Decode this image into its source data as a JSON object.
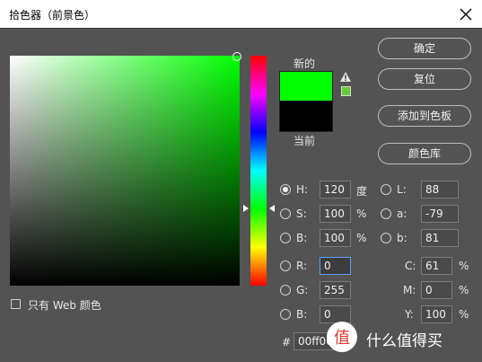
{
  "window": {
    "title": "拾色器（前景色）"
  },
  "swatches": {
    "new_label": "新的",
    "current_label": "当前",
    "new_color": "#00ff00",
    "current_color": "#000000",
    "websafe_color": "#66cc33"
  },
  "buttons": {
    "ok": "确定",
    "reset": "复位",
    "add_to_swatches": "添加到色板",
    "color_libraries": "颜色库"
  },
  "hsb": {
    "h": {
      "label": "H:",
      "value": "120",
      "unit": "度"
    },
    "s": {
      "label": "S:",
      "value": "100",
      "unit": "%"
    },
    "b": {
      "label": "B:",
      "value": "100",
      "unit": "%"
    }
  },
  "lab": {
    "l": {
      "label": "L:",
      "value": "88"
    },
    "a": {
      "label": "a:",
      "value": "-79"
    },
    "b": {
      "label": "b:",
      "value": "81"
    }
  },
  "rgb": {
    "r": {
      "label": "R:",
      "value": "0"
    },
    "g": {
      "label": "G:",
      "value": "255"
    },
    "b": {
      "label": "B:",
      "value": "0"
    }
  },
  "cmyk": {
    "c": {
      "label": "C:",
      "value": "61",
      "unit": "%"
    },
    "m": {
      "label": "M:",
      "value": "0",
      "unit": "%"
    },
    "y": {
      "label": "Y:",
      "value": "100",
      "unit": "%"
    }
  },
  "hex": {
    "label": "#",
    "value": "00ff00"
  },
  "web_only": {
    "label": "只有 Web 颜色"
  },
  "watermark": {
    "text": "值 什么值得买"
  }
}
